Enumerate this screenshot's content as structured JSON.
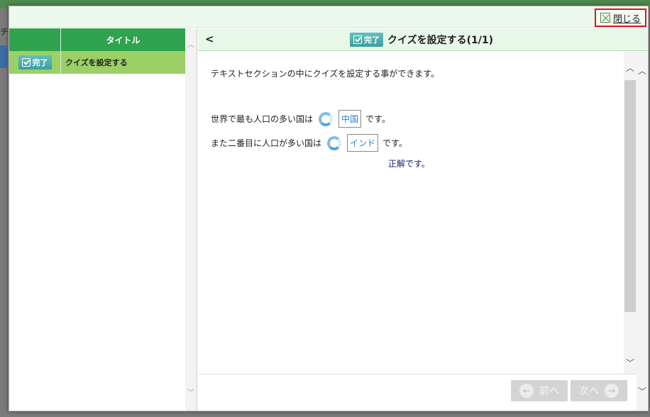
{
  "modal": {
    "close_label": "閉じる"
  },
  "background": {
    "left_char": "チ"
  },
  "left_panel": {
    "column_title": "タイトル",
    "rows": [
      {
        "status": "完了",
        "title": "クイズを設定する"
      }
    ]
  },
  "right_panel": {
    "back_label": "<",
    "status": "完了",
    "title": "クイズを設定する(1/1)",
    "intro": "テキストセクションの中にクイズを設定する事ができます。",
    "quiz": [
      {
        "before": "世界で最も人口の多い国は",
        "answer": "中国",
        "after": "です。"
      },
      {
        "before": "また二番目に人口が多い国は",
        "answer": "インド",
        "after": "です。"
      }
    ],
    "result": "正解です。",
    "prev_label": "前へ",
    "next_label": "次へ"
  },
  "icons": {
    "close": "close-icon",
    "check": "check-icon",
    "spinner": "spinner-icon",
    "prev": "arrow-left-circle-icon",
    "next": "arrow-right-circle-icon"
  },
  "colors": {
    "header_green": "#2fa34d",
    "row_green": "#9ccf66",
    "badge_teal": "#3c9fa0",
    "close_highlight": "#e0141e",
    "answer_blue": "#2a7fc9",
    "result_navy": "#17246e"
  }
}
